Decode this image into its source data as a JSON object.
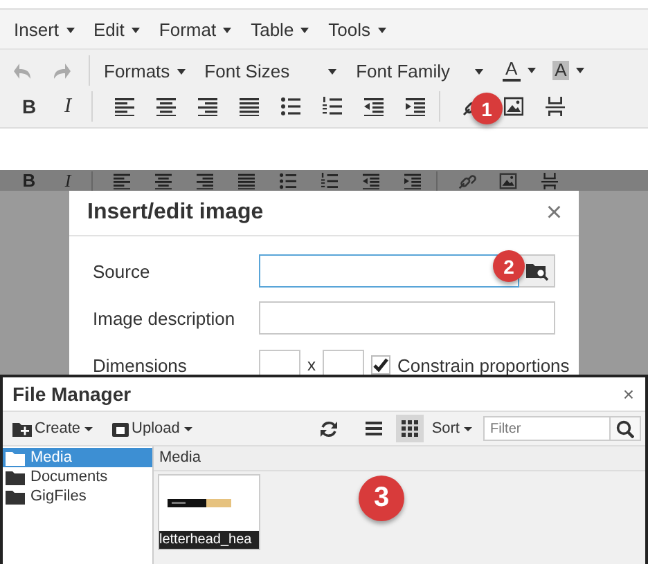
{
  "editor": {
    "menu": [
      {
        "label": "Insert"
      },
      {
        "label": "Edit"
      },
      {
        "label": "Format"
      },
      {
        "label": "Table"
      },
      {
        "label": "Tools"
      }
    ],
    "history": [
      {
        "kind": "undo",
        "disabled": true
      },
      {
        "kind": "redo",
        "disabled": true
      }
    ],
    "dropdowns": [
      {
        "label": "Formats"
      },
      {
        "label": "Font Sizes"
      },
      {
        "label": "Font Family"
      }
    ],
    "color_buttons": [
      {
        "kind": "text",
        "label": "A"
      },
      {
        "kind": "background",
        "label": "A"
      }
    ],
    "format_buttons": [
      {
        "kind": "bold",
        "label": "B"
      },
      {
        "kind": "italic",
        "label": "I"
      }
    ]
  },
  "backdrop_toolbar": {
    "format_buttons": [
      {
        "kind": "bold",
        "label": "B"
      },
      {
        "kind": "italic",
        "label": "I"
      }
    ]
  },
  "dialog": {
    "title": "Insert/edit image",
    "close": "×",
    "fields": [
      {
        "label": "Source",
        "kind": "browse",
        "focused": true
      },
      {
        "label": "Image description",
        "kind": "text",
        "focused": false
      }
    ],
    "dimensions": {
      "label": "Dimensions",
      "separator": "x",
      "constrain": {
        "label": "Constrain proportions",
        "checked": true
      }
    }
  },
  "file_manager": {
    "title": "File Manager",
    "close": "×",
    "toolbar": {
      "create": "Create",
      "upload": "Upload",
      "sort": "Sort",
      "filter_placeholder": "Filter",
      "views": [
        {
          "kind": "list",
          "selected": false
        },
        {
          "kind": "grid",
          "selected": true
        }
      ]
    },
    "folders": [
      {
        "name": "Media",
        "selected": true
      },
      {
        "name": "Documents",
        "selected": false
      },
      {
        "name": "GigFiles",
        "selected": false
      }
    ],
    "path": "Media",
    "files": [
      {
        "name": "letterhead_hea",
        "kind": "picture"
      }
    ]
  },
  "callouts": [
    {
      "number": "1"
    },
    {
      "number": "2"
    },
    {
      "number": "3"
    }
  ]
}
